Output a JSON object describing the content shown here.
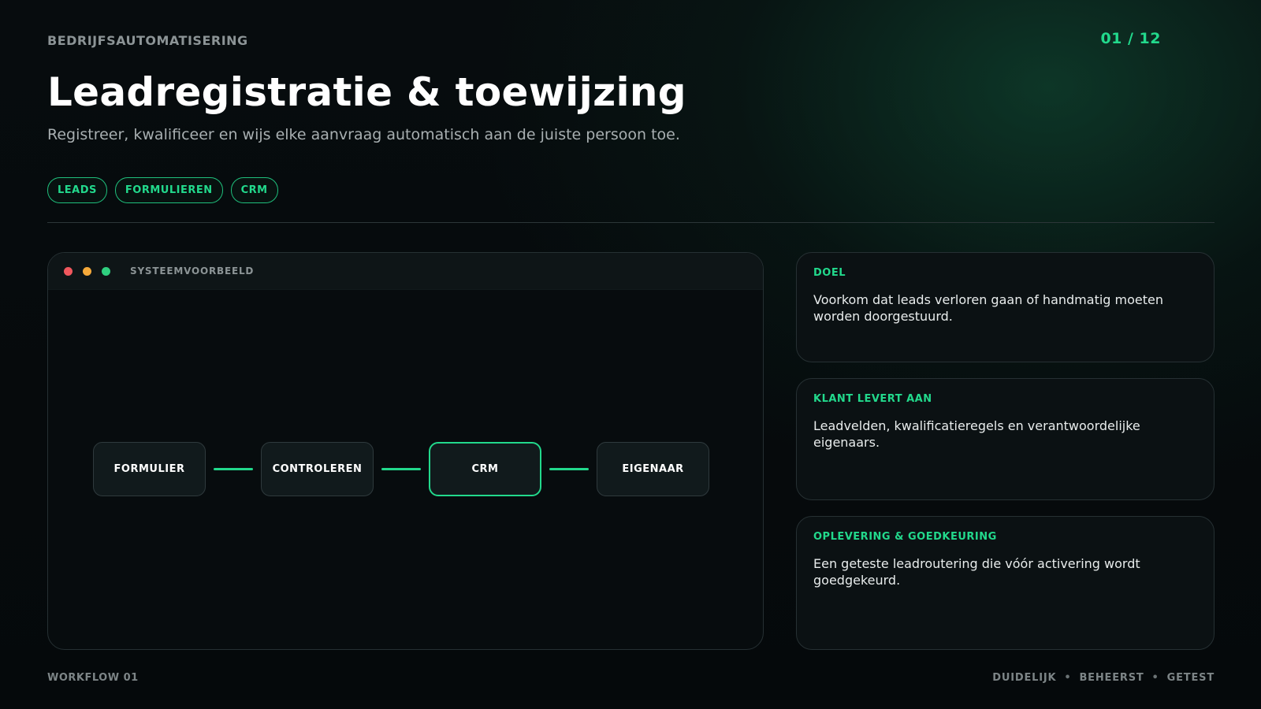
{
  "header": {
    "eyebrow": "BEDRIJFSAUTOMATISERING",
    "page_counter": "01 / 12",
    "title": "Leadregistratie & toewijzing",
    "subtitle": "Registreer, kwalificeer en wijs elke aanvraag automatisch aan de juiste persoon toe."
  },
  "tags": [
    "LEADS",
    "FORMULIEREN",
    "CRM"
  ],
  "system_preview": {
    "label": "SYSTEEMVOORBEELD",
    "nodes": [
      {
        "label": "FORMULIER",
        "active": false
      },
      {
        "label": "CONTROLEREN",
        "active": false
      },
      {
        "label": "CRM",
        "active": true
      },
      {
        "label": "EIGENAAR",
        "active": false
      }
    ]
  },
  "cards": [
    {
      "label": "DOEL",
      "text": "Voorkom dat leads verloren gaan of handmatig moeten worden doorgestuurd."
    },
    {
      "label": "KLANT LEVERT AAN",
      "text": "Leadvelden, kwalificatieregels en verantwoordelijke eigenaars."
    },
    {
      "label": "OPLEVERING & GOEDKEURING",
      "text": "Een geteste leadroutering die vóór activering wordt goedgekeurd."
    }
  ],
  "footer": {
    "left": "WORKFLOW 01",
    "right_items": [
      "DUIDELIJK",
      "BEHEERST",
      "GETEST"
    ],
    "separator": "•"
  },
  "colors": {
    "accent": "#22d98c",
    "background": "#05090b",
    "window_dot_red": "#f0575d",
    "window_dot_yellow": "#f5a93a",
    "window_dot_green": "#2fcf7f"
  }
}
